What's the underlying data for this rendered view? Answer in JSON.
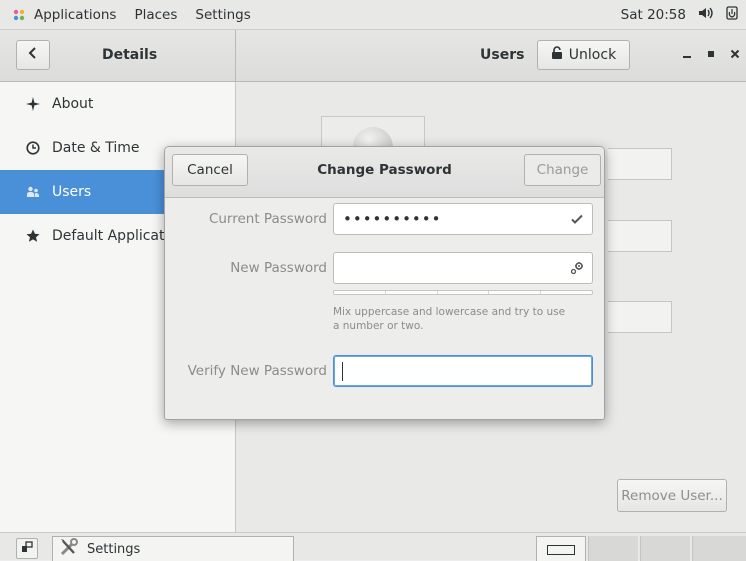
{
  "topbar": {
    "applications": "Applications",
    "places": "Places",
    "settings": "Settings",
    "clock": "Sat 20:58"
  },
  "header": {
    "left_title": "Details",
    "right_title": "Users",
    "unlock_label": "Unlock"
  },
  "sidebar": {
    "items": [
      {
        "label": "About",
        "icon": "plus-star-icon"
      },
      {
        "label": "Date & Time",
        "icon": "clock-icon"
      },
      {
        "label": "Users",
        "icon": "users-icon"
      },
      {
        "label": "Default Applications",
        "icon": "star-icon"
      }
    ],
    "selected_index": 2
  },
  "content": {
    "remove_user_label": "Remove User..."
  },
  "dialog": {
    "title": "Change Password",
    "cancel_label": "Cancel",
    "change_label": "Change",
    "current_password_label": "Current Password",
    "current_password_value": "••••••••••",
    "new_password_label": "New Password",
    "new_password_value": "",
    "hint": "Mix uppercase and lowercase and try to use a number or two.",
    "verify_label": "Verify New Password",
    "verify_value": "",
    "strength_level": 0
  },
  "taskbar": {
    "window_label": "Settings"
  },
  "colors": {
    "accent": "#4a90d9",
    "disabled_text": "#9a9c98"
  }
}
